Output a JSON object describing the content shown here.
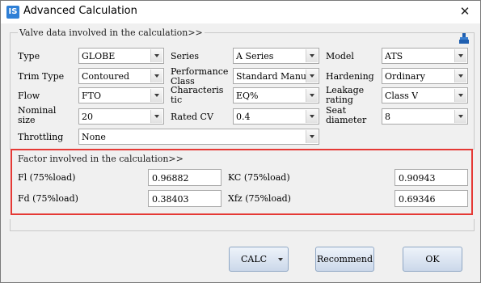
{
  "window": {
    "title": "Advanced Calculation",
    "app_icon": "IS"
  },
  "valve_group": {
    "title": "Valve data involved in the calculation>>",
    "labels": {
      "type": "Type",
      "series": "Series",
      "model": "Model",
      "trim_type": "Trim Type",
      "performance_class": "Performance Class",
      "hardening": "Hardening",
      "flow": "Flow",
      "characteristic": "Characteris tic",
      "leakage_rating": "Leakage rating",
      "nominal_size": "Nominal size",
      "rated_cv": "Rated CV",
      "seat_diameter": "Seat diameter",
      "throttling": "Throttling"
    },
    "values": {
      "type": "GLOBE",
      "series": "A Series",
      "model": "ATS",
      "trim_type": "Contoured",
      "performance_class": "Standard Manuf",
      "hardening": "Ordinary",
      "flow": "FTO",
      "characteristic": "EQ%",
      "leakage_rating": "Class V",
      "nominal_size": "20",
      "rated_cv": "0.4",
      "seat_diameter": "8",
      "throttling": "None"
    }
  },
  "factor_group": {
    "title": "Factor involved in the calculation>>",
    "fl_label": "Fl (75%load)",
    "fl_value": "0.96882",
    "kc_label": "KC (75%load)",
    "kc_value": "0.90943",
    "fd_label": "Fd (75%load)",
    "fd_value": "0.38403",
    "xfz_label": "Xfz (75%load)",
    "xfz_value": "0.69346"
  },
  "buttons": {
    "calc": "CALC",
    "recommend": "Recommend",
    "ok": "OK"
  },
  "colors": {
    "highlight_border": "#e53935",
    "button_border": "#8fa7c4"
  }
}
